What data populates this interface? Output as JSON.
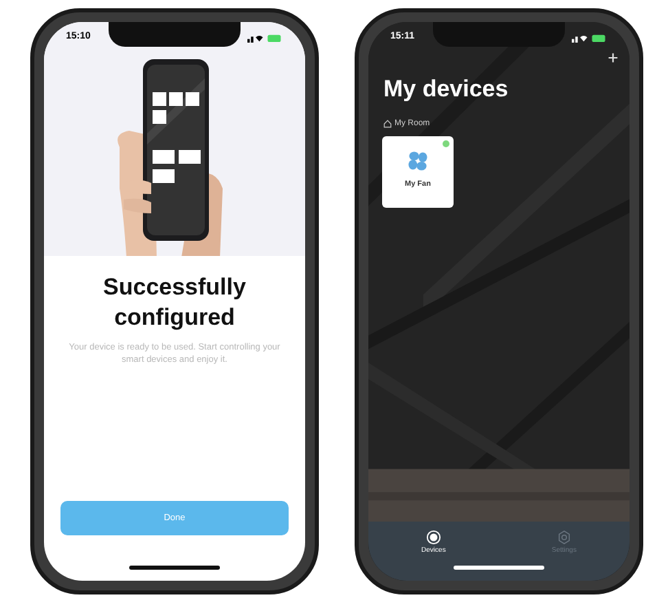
{
  "phones": [
    {
      "kind": "setup_done",
      "status_time": "15:10",
      "title": "Successfully configured",
      "message": "Your device is ready to be used. Start controlling your smart devices and enjoy it.",
      "button": "Done"
    },
    {
      "kind": "devices",
      "status_time": "15:11",
      "title": "My devices",
      "room": "My Room",
      "devices": [
        {
          "name": "My Fan",
          "online": true
        }
      ],
      "tabs": [
        {
          "label": "Devices",
          "selected": true
        },
        {
          "label": "Settings",
          "selected": false
        }
      ]
    }
  ]
}
